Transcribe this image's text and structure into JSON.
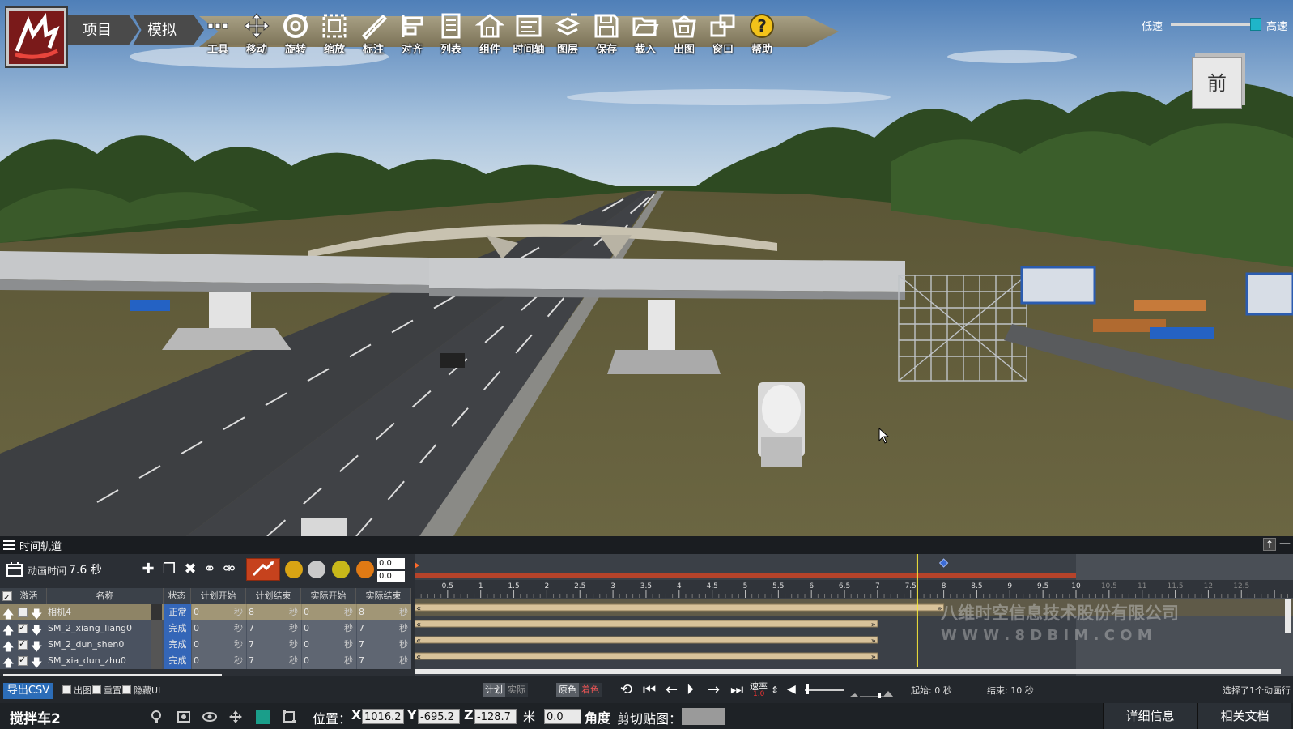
{
  "breadcrumb": [
    "项目",
    "模拟"
  ],
  "toolbar": {
    "tools": [
      {
        "label": "工具",
        "icon": "tools-icon"
      },
      {
        "label": "移动",
        "icon": "move-icon"
      },
      {
        "label": "旋转",
        "icon": "rotate-icon"
      },
      {
        "label": "缩放",
        "icon": "scale-icon"
      },
      {
        "label": "标注",
        "icon": "annotate-icon"
      },
      {
        "label": "对齐",
        "icon": "align-icon"
      },
      {
        "label": "列表",
        "icon": "list-icon"
      },
      {
        "label": "组件",
        "icon": "component-icon"
      },
      {
        "label": "时间轴",
        "icon": "timeline-icon"
      },
      {
        "label": "图层",
        "icon": "layers-icon"
      },
      {
        "label": "保存",
        "icon": "save-icon"
      },
      {
        "label": "载入",
        "icon": "load-icon"
      },
      {
        "label": "出图",
        "icon": "export-image-icon"
      },
      {
        "label": "窗口",
        "icon": "window-icon"
      },
      {
        "label": "帮助",
        "icon": "help-icon"
      }
    ]
  },
  "speed": {
    "low": "低速",
    "high": "高速",
    "level": 0.95
  },
  "viewcube": {
    "label": "前"
  },
  "timeline": {
    "title": "时间轨道",
    "anim_time_label": "动画时间",
    "anim_time_value": "7.6 秒",
    "num_a": "0.0",
    "num_b": "0.0",
    "columns": [
      "激活",
      "名称",
      "状态",
      "计划开始",
      "计划结束",
      "实际开始",
      "实际结束"
    ],
    "unit": "秒",
    "rows": [
      {
        "name": "相机4",
        "status": "正常",
        "plan_start": "0",
        "plan_end": "8",
        "actual_start": "0",
        "actual_end": "8",
        "active": false,
        "selected": true
      },
      {
        "name": "SM_2_xiang_liang0",
        "status": "完成",
        "plan_start": "0",
        "plan_end": "7",
        "actual_start": "0",
        "actual_end": "7",
        "active": true,
        "selected": false
      },
      {
        "name": "SM_2_dun_shen0",
        "status": "完成",
        "plan_start": "0",
        "plan_end": "7",
        "actual_start": "0",
        "actual_end": "7",
        "active": true,
        "selected": false
      },
      {
        "name": "SM_xia_dun_zhu0",
        "status": "完成",
        "plan_start": "0",
        "plan_end": "7",
        "actual_start": "0",
        "actual_end": "7",
        "active": true,
        "selected": false
      }
    ],
    "ruler_ticks": [
      "0.5",
      "1",
      "1.5",
      "2",
      "2.5",
      "3",
      "3.5",
      "4",
      "4.5",
      "5",
      "5.5",
      "6",
      "6.5",
      "7",
      "7.5",
      "8",
      "8.5",
      "9",
      "9.5",
      "10",
      "10.5",
      "11",
      "11.5",
      "12",
      "12.5"
    ],
    "ruler_max": 10,
    "playhead": 7.6,
    "keyframe": 8,
    "bars": [
      8,
      7,
      7,
      7
    ],
    "watermark_company": "八维时空信息技术股份有限公司",
    "watermark_url": "W W W . 8 D B I M . C O M"
  },
  "controls": {
    "export_csv": "导出CSV",
    "chk_export": "出图",
    "chk_reset": "重置",
    "chk_hide_ui": "隐藏UI",
    "plan": "计划",
    "actual": "实际",
    "original_color": "原色",
    "tint_color": "着色",
    "rate_label": "速率",
    "rate_value": "1.0",
    "start_label": "起始: 0  秒",
    "end_label": "结束: 10  秒",
    "selected_label": "选择了1个动画行"
  },
  "status": {
    "object_name": "搅拌车2",
    "position_label": "位置：",
    "x": "1016.2",
    "y": "-695.2",
    "z": "-128.7",
    "unit": "米",
    "angle_value": "0.0",
    "angle_label": "角度",
    "clipboard_label": "剪切贴图：",
    "tab_details": "详细信息",
    "tab_docs": "相关文档"
  }
}
